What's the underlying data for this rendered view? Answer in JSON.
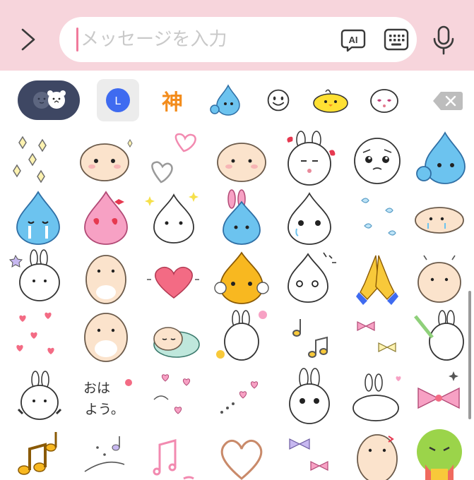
{
  "input": {
    "placeholder": "メッセージを入力",
    "ai_label": "AI"
  },
  "tabs": {
    "recent_label": "L",
    "kanji_label": "神"
  },
  "colors": {
    "top_bar": "#f7d5dc",
    "accent_pink": "#f07a9c",
    "toggle_bg": "#3e4763",
    "selected_tab_bg": "#ececec",
    "recent_blue": "#3f6bf0",
    "kanji_orange": "#f38c1c"
  },
  "grid": {
    "ohayou_line1": "おは",
    "ohayou_line2": "よう。"
  },
  "icons": [
    "chevron-right-icon",
    "ai-icon",
    "keyboard-icon",
    "microphone-icon",
    "face-toggle-icon",
    "recent-clock-icon",
    "kanji-sticker-icon",
    "water-drop-character-icon",
    "smiley-icon",
    "yellow-chick-icon",
    "rice-ball-face-icon",
    "backspace-icon"
  ]
}
